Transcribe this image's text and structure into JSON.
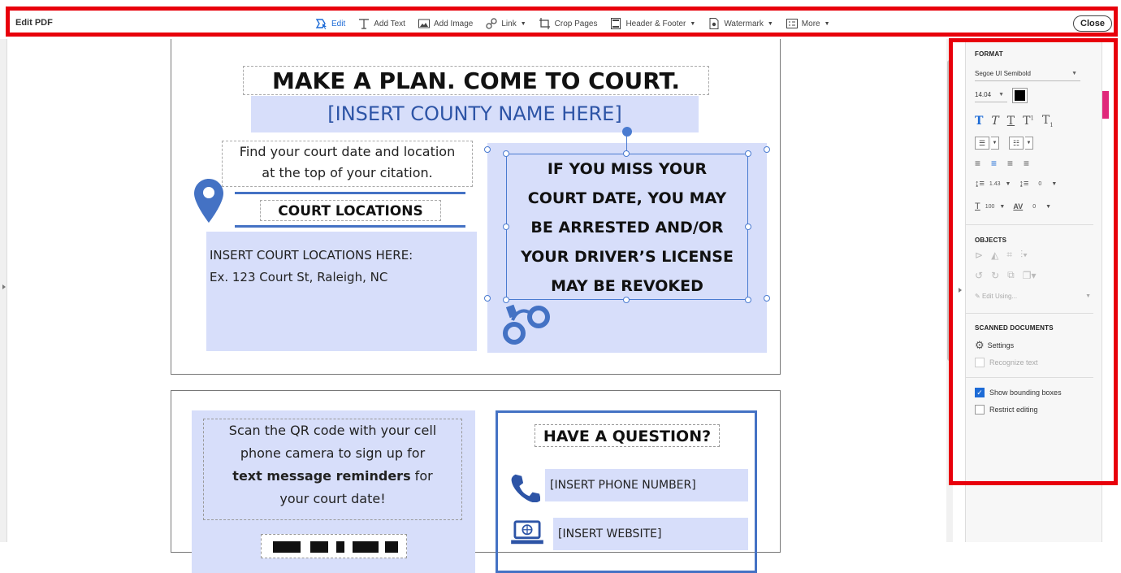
{
  "toolbar": {
    "title": "Edit PDF",
    "tools": [
      {
        "label": "Edit",
        "icon": "edit-cursor-icon",
        "active": true
      },
      {
        "label": "Add Text",
        "icon": "add-text-icon"
      },
      {
        "label": "Add Image",
        "icon": "add-image-icon"
      },
      {
        "label": "Link",
        "icon": "link-icon",
        "dropdown": true
      },
      {
        "label": "Crop Pages",
        "icon": "crop-icon"
      },
      {
        "label": "Header & Footer",
        "icon": "header-footer-icon",
        "dropdown": true
      },
      {
        "label": "Watermark",
        "icon": "watermark-icon",
        "dropdown": true
      },
      {
        "label": "More",
        "icon": "more-icon",
        "dropdown": true
      }
    ],
    "close_label": "Close"
  },
  "document": {
    "page1": {
      "headline": "MAKE A PLAN. COME TO COURT.",
      "county": "[INSERT COUNTY NAME HERE]",
      "find_line1": "Find your court date and location",
      "find_line2": "at the top of your citation.",
      "court_locations_title": "COURT LOCATIONS",
      "locations_line1": "INSERT COURT LOCATIONS HERE:",
      "locations_line2": "Ex. 123 Court St, Raleigh, NC",
      "warning_lines": [
        "IF YOU MISS YOUR",
        "COURT DATE, YOU MAY",
        "BE ARRESTED AND/OR",
        "YOUR DRIVER’S LICENSE",
        "MAY BE REVOKED"
      ]
    },
    "page2": {
      "qr_line1": "Scan the QR code with your cell",
      "qr_line2": "phone camera to sign up for",
      "qr_bold": "text message reminders",
      "qr_line3_rest": " for",
      "qr_line4": "your court date!",
      "question_title": "HAVE A QUESTION?",
      "phone": "[INSERT PHONE NUMBER]",
      "website": "[INSERT WEBSITE]"
    }
  },
  "panel": {
    "format_title": "FORMAT",
    "font_name": "Segoe UI Semibold",
    "font_size": "14.04",
    "font_color": "#000000",
    "line_spacing": "1.43",
    "para_spacing": "0",
    "horiz_scale": "100",
    "char_spacing": "0",
    "objects_title": "OBJECTS",
    "edit_using": "Edit Using...",
    "scanned_title": "SCANNED DOCUMENTS",
    "settings_label": "Settings",
    "recognize_label": "Recognize text",
    "show_bounding_label": "Show bounding boxes",
    "show_bounding_checked": true,
    "restrict_label": "Restrict editing",
    "restrict_checked": false
  },
  "colors": {
    "accent": "#1d6bd6",
    "highlight_outline": "#e8000b",
    "doc_fill": "#d7defa",
    "doc_blue": "#4472c4"
  }
}
